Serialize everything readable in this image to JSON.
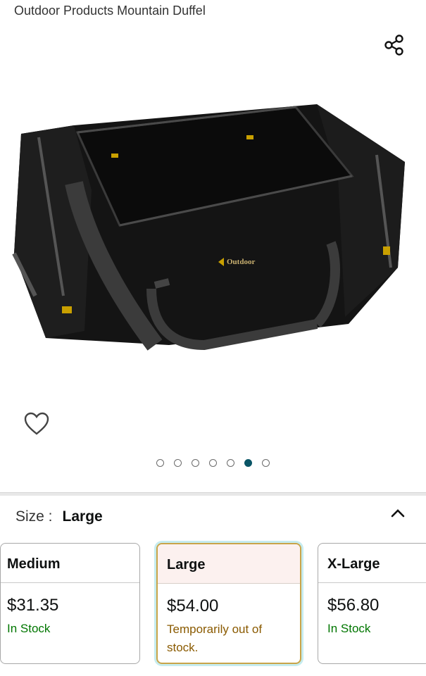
{
  "product": {
    "title": "Outdoor Products Mountain Duffel"
  },
  "icons": {
    "share": "share-icon",
    "favorite": "heart-icon",
    "collapse": "chevron-up-icon"
  },
  "carousel": {
    "count": 7,
    "active_index": 5,
    "active_color": "#0a5566"
  },
  "size": {
    "label": "Size :",
    "selected": "Large"
  },
  "options": [
    {
      "name": "Medium",
      "price": "$31.35",
      "stock": "In Stock",
      "status": "in",
      "selected": false
    },
    {
      "name": "Large",
      "price": "$54.00",
      "stock": "Temporarily out of stock.",
      "status": "oos",
      "selected": true
    },
    {
      "name": "X-Large",
      "price": "$56.80",
      "stock": "In Stock",
      "status": "in",
      "selected": false
    }
  ],
  "colors": {
    "in_stock": "#007600",
    "out_of_stock": "#8a5a00",
    "selected_border": "#c9a449"
  }
}
